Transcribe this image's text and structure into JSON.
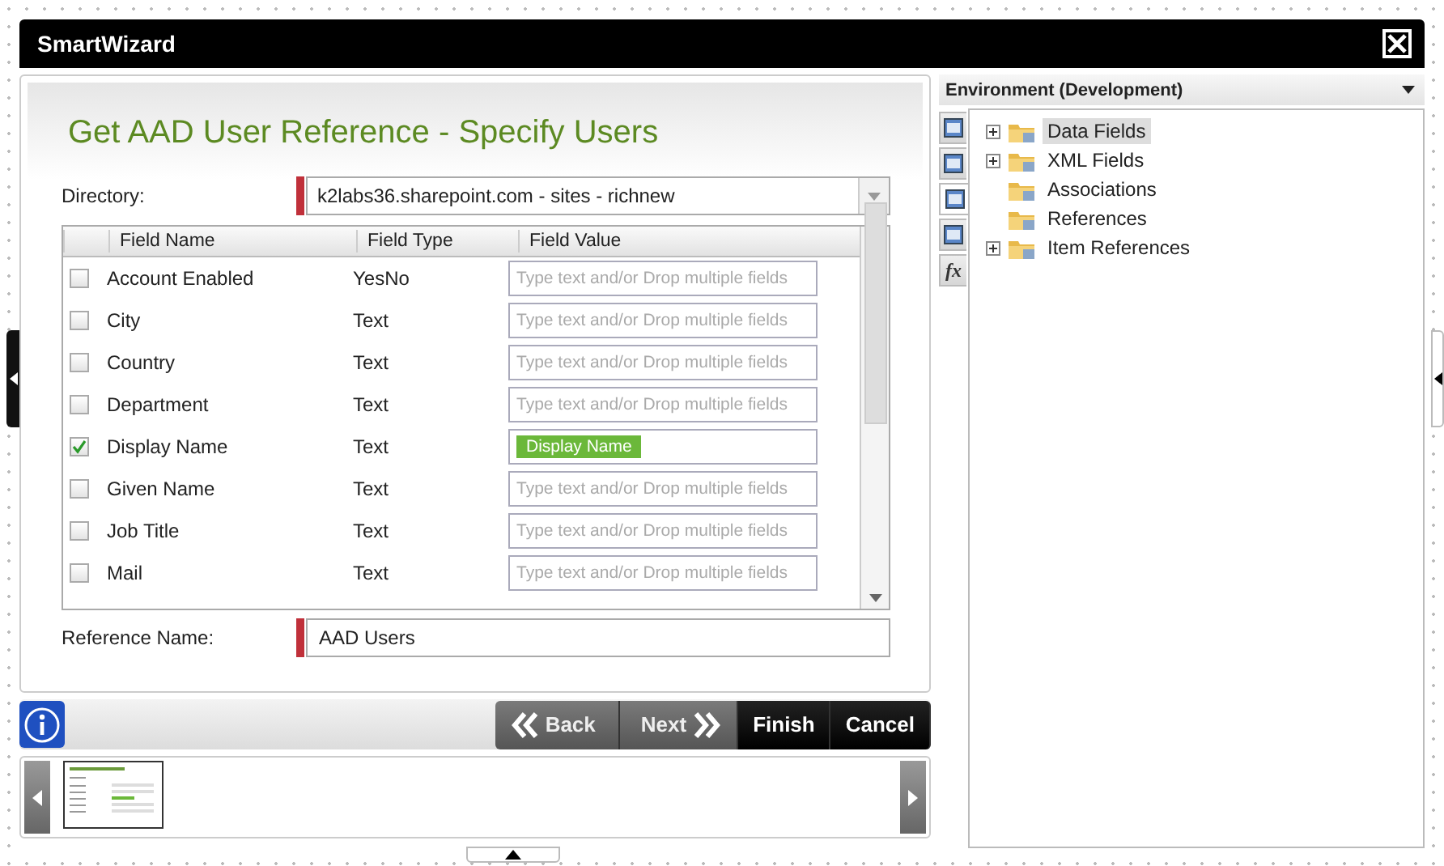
{
  "window": {
    "title": "SmartWizard"
  },
  "page": {
    "title": "Get AAD User Reference - Specify Users",
    "directory": {
      "label": "Directory:",
      "value": "k2labs36.sharepoint.com - sites - richnew"
    },
    "grid": {
      "columns": [
        "Field Name",
        "Field Type",
        "Field Value"
      ],
      "rows": [
        {
          "name": "Account Enabled",
          "type": "YesNo",
          "checked": false,
          "kind": "empty",
          "placeholder": "Type text and/or Drop multiple fields"
        },
        {
          "name": "City",
          "type": "Text",
          "checked": false,
          "kind": "empty",
          "placeholder": "Type text and/or Drop multiple fields"
        },
        {
          "name": "Country",
          "type": "Text",
          "checked": false,
          "kind": "empty",
          "placeholder": "Type text and/or Drop multiple fields"
        },
        {
          "name": "Department",
          "type": "Text",
          "checked": false,
          "kind": "empty",
          "placeholder": "Type text and/or Drop multiple fields"
        },
        {
          "name": "Display Name",
          "type": "Text",
          "checked": true,
          "kind": "token",
          "value": "Display Name"
        },
        {
          "name": "Given Name",
          "type": "Text",
          "checked": false,
          "kind": "empty",
          "placeholder": "Type text and/or Drop multiple fields"
        },
        {
          "name": "Job Title",
          "type": "Text",
          "checked": false,
          "kind": "empty",
          "placeholder": "Type text and/or Drop multiple fields"
        },
        {
          "name": "Mail",
          "type": "Text",
          "checked": false,
          "kind": "empty",
          "placeholder": "Type text and/or Drop multiple fields"
        }
      ]
    },
    "reference_name": {
      "label": "Reference Name:",
      "value": "AAD Users"
    }
  },
  "buttons": [
    {
      "label": "Back",
      "kind": "back"
    },
    {
      "label": "Next",
      "kind": "next"
    },
    {
      "label": "Finish",
      "kind": "plain"
    },
    {
      "label": "Cancel",
      "kind": "plain"
    }
  ],
  "environment": {
    "title": "Environment (Development)",
    "side_tabs": [
      {
        "kind": "icon",
        "selected": false
      },
      {
        "kind": "icon",
        "selected": false
      },
      {
        "kind": "icon",
        "selected": true
      },
      {
        "kind": "icon",
        "selected": false
      },
      {
        "kind": "text",
        "label": "fx",
        "selected": false
      }
    ],
    "tree": [
      {
        "label": "Data Fields",
        "expandable": true,
        "selected": true
      },
      {
        "label": "XML Fields",
        "expandable": true,
        "selected": false
      },
      {
        "label": "Associations",
        "expandable": false,
        "selected": false
      },
      {
        "label": "References",
        "expandable": false,
        "selected": false
      },
      {
        "label": "Item References",
        "expandable": true,
        "selected": false
      }
    ]
  }
}
